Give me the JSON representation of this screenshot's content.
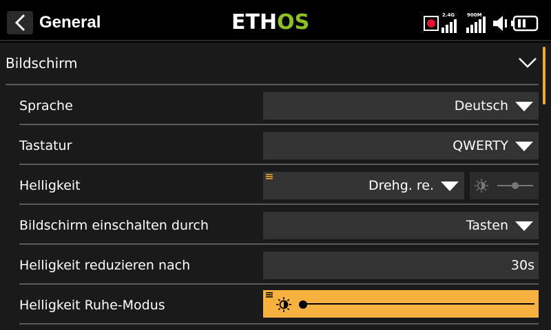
{
  "header": {
    "title": "General",
    "logo_white": "ETH",
    "logo_green": "OS",
    "signal_24_label": "2.4G",
    "signal_900_label": "900M",
    "back_icon": "chevron-left-icon",
    "colors": {
      "accent": "#f2a830",
      "logo_green": "#8dc21f",
      "record": "#e8112d"
    }
  },
  "section": {
    "title": "Bildschirm",
    "icon": "chevron-down-icon"
  },
  "rows": [
    {
      "label": "Sprache",
      "value": "Deutsch"
    },
    {
      "label": "Tastatur",
      "value": "QWERTY"
    },
    {
      "label": "Helligkeit",
      "value": "Drehg. re.",
      "slider_level": 0.5
    },
    {
      "label": "Bildschirm einschalten durch",
      "value": "Tasten"
    },
    {
      "label": "Helligkeit reduzieren nach",
      "value": "30s"
    },
    {
      "label": "Helligkeit Ruhe-Modus",
      "slider_level": 0.0
    }
  ]
}
